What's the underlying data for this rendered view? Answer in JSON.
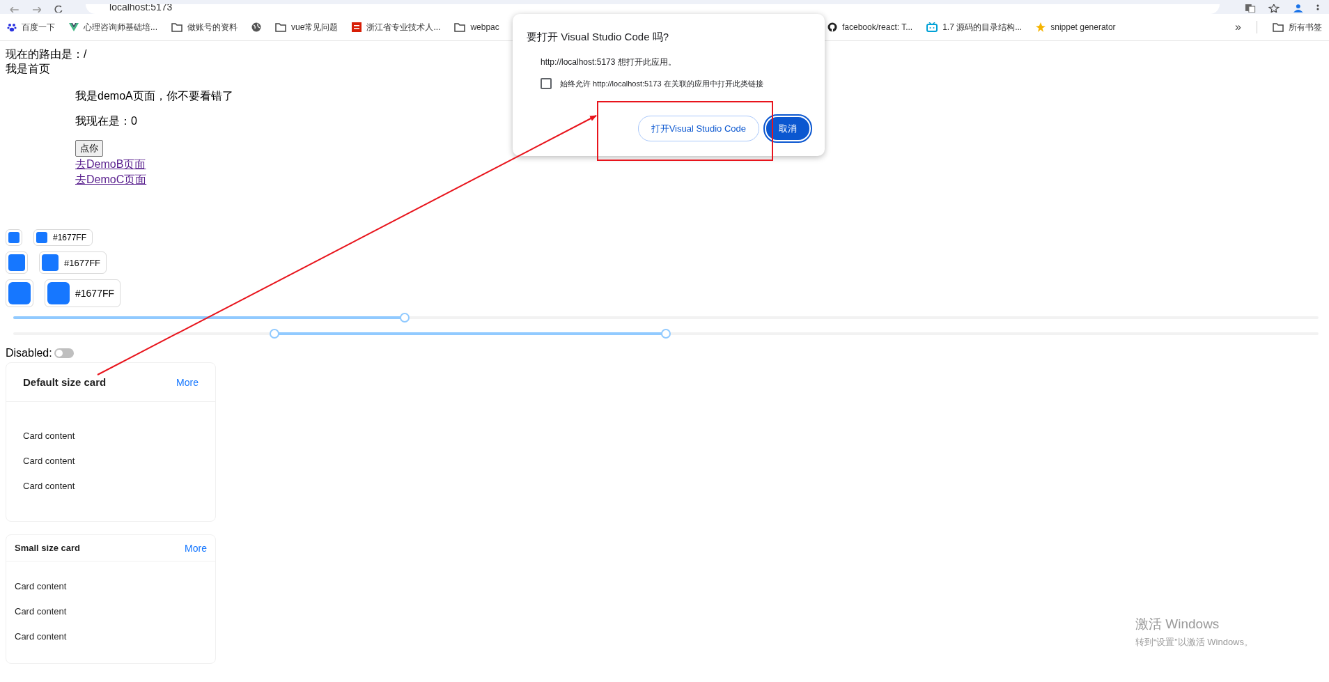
{
  "browser": {
    "address": "localhost:5173",
    "bookmarks": [
      {
        "label": "百度一下",
        "kind": "paw"
      },
      {
        "label": "心理咨询师基础培...",
        "kind": "vee"
      },
      {
        "label": "做账号的资料",
        "kind": "folder"
      },
      {
        "kind": "globe"
      },
      {
        "label": "vue常见问题",
        "kind": "folder"
      },
      {
        "label": "浙江省专业技术人...",
        "kind": "badge"
      },
      {
        "label": "webpac",
        "kind": "folder"
      }
    ],
    "bookmarks_right": [
      {
        "label": "facebook/react: T...",
        "kind": "cat"
      },
      {
        "label": "1.7 源码的目录结构...",
        "kind": "tv"
      },
      {
        "label": "snippet generator",
        "kind": "star"
      }
    ],
    "overflow": "»",
    "all_bookmarks": "所有书签"
  },
  "page": {
    "route_line": "现在的路由是：/",
    "home": "我是首页",
    "demo_title": "我是demoA页面，你不要看错了",
    "count_line": "我现在是：0",
    "button": "点你",
    "links": [
      "去DemoB页面",
      "去DemoC页面"
    ]
  },
  "color_pickers": [
    {
      "kind": "small",
      "value": "#1677FF"
    },
    {
      "kind": "middle",
      "value": "#1677FF"
    },
    {
      "kind": "large",
      "value": "#1677FF"
    }
  ],
  "sliders": [
    {
      "kind": "single",
      "thumbs": [
        {
          "level": 0.3
        }
      ]
    },
    {
      "kind": "range",
      "thumbs": [
        {
          "level": 0.2
        },
        {
          "level": 0.5
        }
      ]
    }
  ],
  "switch": {
    "label": "Disabled:",
    "on": false
  },
  "cards": [
    {
      "kind": "default",
      "title": "Default size card",
      "extra": "More",
      "lines": [
        "Card content",
        "Card content",
        "Card content"
      ]
    },
    {
      "kind": "small",
      "title": "Small size card",
      "extra": "More",
      "lines": [
        "Card content",
        "Card content",
        "Card content"
      ]
    }
  ],
  "dialog": {
    "title": "要打开 Visual Studio Code 吗?",
    "message": "http://localhost:5173 想打开此应用。",
    "checkbox": {
      "label": "始终允许 http://localhost:5173 在关联的应用中打开此类链接",
      "checked": false
    },
    "buttons": [
      {
        "label": "打开Visual Studio Code",
        "kind": "secondary"
      },
      {
        "label": "取消",
        "kind": "primary"
      }
    ]
  },
  "os_notice": {
    "title": "激活 Windows",
    "subtitle": "转到“设置”以激活 Windows。"
  }
}
